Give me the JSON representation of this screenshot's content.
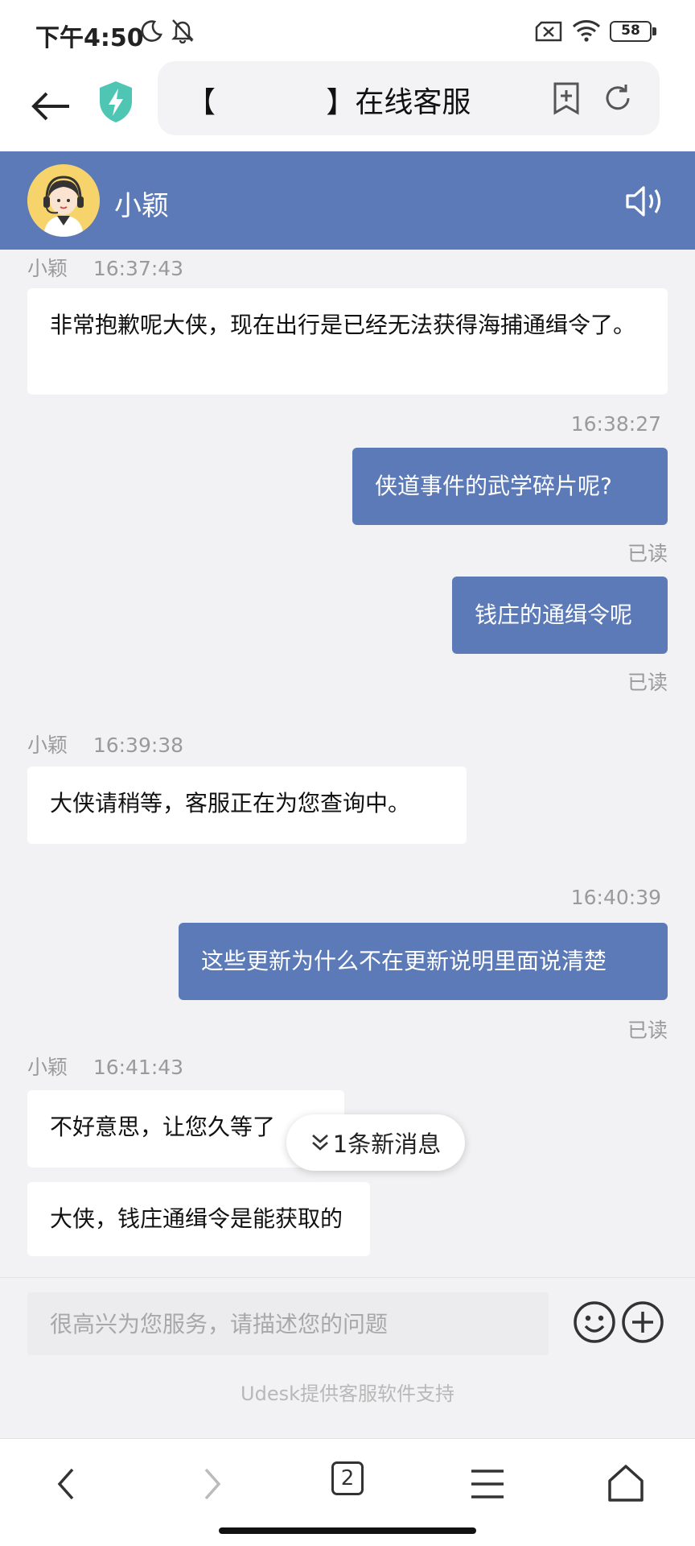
{
  "status_bar": {
    "time": "下午4:50",
    "battery": "58"
  },
  "browser": {
    "url_title": "【            】在线客服"
  },
  "chat_header": {
    "agent_name": "小颖"
  },
  "messages": [
    {
      "sender": "小颖",
      "time": "16:37:43",
      "text": "非常抱歉呢大侠，现在出行是已经无法获得海捕通缉令了。"
    },
    {
      "time": "16:38:27",
      "text": "侠道事件的武学碎片呢?",
      "status": "已读"
    },
    {
      "text": "钱庄的通缉令呢",
      "status": "已读"
    },
    {
      "sender": "小颖",
      "time": "16:39:38",
      "text": "大侠请稍等，客服正在为您查询中。"
    },
    {
      "time": "16:40:39",
      "text": "这些更新为什么不在更新说明里面说清楚",
      "status": "已读"
    },
    {
      "sender": "小颖",
      "time": "16:41:43",
      "text": "不好意思，让您久等了"
    },
    {
      "text": "大侠，钱庄通缉令是能获取的"
    }
  ],
  "new_message_pill": "1条新消息",
  "input": {
    "placeholder": "很高兴为您服务，请描述您的问题"
  },
  "powered_by": "Udesk提供客服软件支持",
  "bottom_nav": {
    "tab_count": "2"
  },
  "colors": {
    "accent": "#5b7ab7",
    "background": "#f2f2f4"
  }
}
